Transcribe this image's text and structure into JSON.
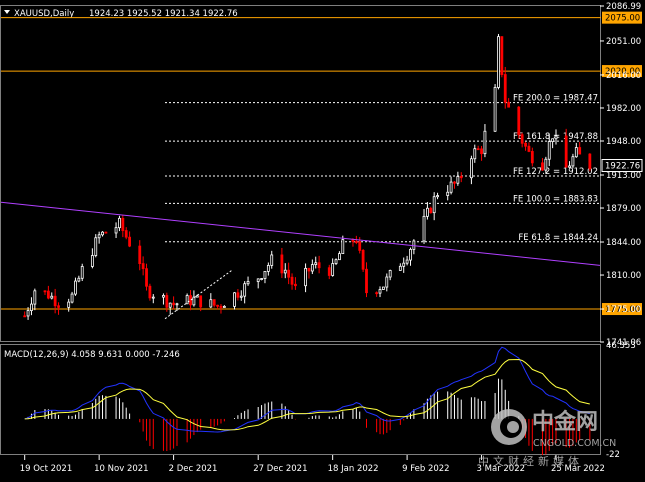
{
  "header": {
    "symbol": "XAUUSD,Daily",
    "ohlc": "1924.23 1925.52 1921.34 1922.76"
  },
  "chart_data": [
    {
      "type": "candlestick",
      "symbol": "XAUUSD",
      "timeframe": "Daily",
      "ylim": [
        1741.06,
        2086.99
      ],
      "y_ticks": [
        "2086.99",
        "2051.00",
        "2016.00",
        "1982.00",
        "1948.00",
        "1913.00",
        "1879.00",
        "1844.00",
        "1810.00",
        "1775.00",
        "1741.06"
      ],
      "x_ticks": [
        "19 Oct 2021",
        "10 Nov 2021",
        "2 Dec 2021",
        "27 Dec 2021",
        "18 Jan 2022",
        "9 Feb 2022",
        "3 Mar 2022",
        "25 Mar 2022"
      ],
      "last_price": "1922.76",
      "colors": {
        "bull": "#ffffff",
        "bear": "#ff0000",
        "axis": "#ffffff",
        "level": "#ffa500",
        "fib": "#ffffff",
        "trendline": "#b040ff"
      },
      "horizontal_levels": [
        {
          "label": "2075.00",
          "value": 2075.0
        },
        {
          "label": "2020.00",
          "value": 2020.0
        },
        {
          "label": "1775.00",
          "value": 1775.0
        }
      ],
      "fibonacci_levels": [
        {
          "label": "FE 200.0 = 1987.47",
          "value": 1987.47
        },
        {
          "label": "FE 161.8 = 1947.88",
          "value": 1947.88
        },
        {
          "label": "FE 127.2 = 1912.02",
          "value": 1912.02
        },
        {
          "label": "FE 100.0 = 1883.83",
          "value": 1883.83
        },
        {
          "label": "FE 61.8 = 1844.24",
          "value": 1844.24
        }
      ],
      "trendline": {
        "start": [
          "Oct 2021",
          1885
        ],
        "end": [
          "Apr 2022",
          1820
        ]
      },
      "support_line": {
        "start": [
          "Nov 2021",
          1765
        ],
        "end": [
          "Jan 2022",
          1815
        ]
      },
      "anchors": [
        [
          "19 Oct 2021",
          1768
        ],
        [
          "22 Oct 2021",
          1795
        ],
        [
          "26 Oct 2021",
          1790
        ],
        [
          "29 Oct 2021",
          1782
        ],
        [
          "2 Nov 2021",
          1788
        ],
        [
          "5 Nov 2021",
          1815
        ],
        [
          "10 Nov 2021",
          1850
        ],
        [
          "16 Nov 2021",
          1862
        ],
        [
          "22 Nov 2021",
          1825
        ],
        [
          "24 Nov 2021",
          1795
        ],
        [
          "2 Dec 2021",
          1780
        ],
        [
          "8 Dec 2021",
          1785
        ],
        [
          "15 Dec 2021",
          1778
        ],
        [
          "20 Dec 2021",
          1790
        ],
        [
          "27 Dec 2021",
          1808
        ],
        [
          "31 Dec 2021",
          1825
        ],
        [
          "4 Jan 2022",
          1815
        ],
        [
          "7 Jan 2022",
          1795
        ],
        [
          "12 Jan 2022",
          1820
        ],
        [
          "18 Jan 2022",
          1815
        ],
        [
          "21 Jan 2022",
          1840
        ],
        [
          "25 Jan 2022",
          1848
        ],
        [
          "28 Jan 2022",
          1793
        ],
        [
          "2 Feb 2022",
          1800
        ],
        [
          "9 Feb 2022",
          1832
        ],
        [
          "14 Feb 2022",
          1865
        ],
        [
          "18 Feb 2022",
          1895
        ],
        [
          "24 Feb 2022",
          1905
        ],
        [
          "28 Feb 2022",
          1935
        ],
        [
          "3 Mar 2022",
          1940
        ],
        [
          "7 Mar 2022",
          1998
        ],
        [
          "8 Mar 2022",
          2050
        ],
        [
          "10 Mar 2022",
          1990
        ],
        [
          "14 Mar 2022",
          1955
        ],
        [
          "17 Mar 2022",
          1935
        ],
        [
          "21 Mar 2022",
          1925
        ],
        [
          "24 Mar 2022",
          1955
        ],
        [
          "28 Mar 2022",
          1920
        ],
        [
          "31 Mar 2022",
          1935
        ],
        [
          "4 Apr 2022",
          1923
        ]
      ]
    },
    {
      "type": "bar",
      "title": "MACD(12,26,9) 4.058 9.631 0.000 -7.246",
      "ylim": [
        -22,
        46.353
      ],
      "y_ticks": [
        "46.353",
        "-22"
      ],
      "series": [
        {
          "name": "MACD",
          "values": [
            4.058
          ]
        },
        {
          "name": "Signal",
          "values": [
            9.631
          ]
        }
      ],
      "colors": {
        "positive": "#ffffff",
        "negative": "#ff0000",
        "macd_line": "#2233ff",
        "signal_line": "#ffff40"
      }
    }
  ],
  "watermark": {
    "brand_cn": "中金网",
    "domain": "CNGOLD.COM.CN",
    "slogan": "中文财经新媒体"
  }
}
